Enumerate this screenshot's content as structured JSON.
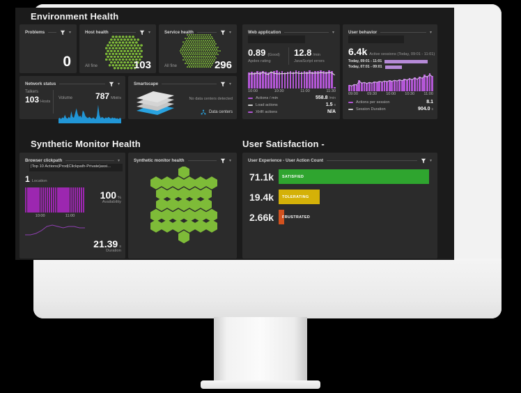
{
  "sections": {
    "environment_health": "Environment Health",
    "synthetic_monitor_health": "Synthetic Monitor Health",
    "user_satisfaction": "User Satisfaction -"
  },
  "tiles": {
    "problems": {
      "title": "Problems",
      "value": "0"
    },
    "host_health": {
      "title": "Host health",
      "status": "All fine",
      "value": "103"
    },
    "service_health": {
      "title": "Service health",
      "status": "All fine",
      "value": "296"
    },
    "network_status": {
      "title": "Network status",
      "talkers_label": "Talkers",
      "talkers_value": "103",
      "talkers_unit": "Hosts",
      "volume_label": "Volume",
      "volume_value": "787",
      "volume_unit": "Mbit/s"
    },
    "smartscape": {
      "title": "Smartscape",
      "empty_text": "No data centers detected",
      "link": "Data centers"
    },
    "web_application": {
      "title": "Web application",
      "apdex_value": "0.89",
      "apdex_qualifier": "(Good)",
      "apdex_label": "Apdex rating",
      "js_value": "12.8",
      "js_unit": "/min",
      "js_label": "JavaScript errors",
      "xticks": [
        "10:00",
        "10:30",
        "11:00",
        "11:30"
      ],
      "legend": [
        {
          "name": "Actions / min",
          "value": "558.8",
          "unit": "/min",
          "color": "#b357d6"
        },
        {
          "name": "Load actions",
          "value": "1.5",
          "unit": "s",
          "color": "#cfcfcf"
        },
        {
          "name": "XHR actions",
          "value": "N/A",
          "unit": "",
          "color": "#b357d6"
        }
      ]
    },
    "user_behavior": {
      "title": "User behavior",
      "sessions_value": "6.4k",
      "sessions_label": "Active sessions (Today, 09:01 - 11:01)",
      "compare": [
        {
          "label": "Today, 09:01 - 11:01",
          "pct": 100
        },
        {
          "label": "Today, 07:01 - 09:01",
          "pct": 40
        }
      ],
      "xticks": [
        "09:00",
        "09:30",
        "10:00",
        "10:30",
        "11:00"
      ],
      "legend": [
        {
          "name": "Actions per session",
          "value": "8.1",
          "unit": "",
          "color": "#b357d6"
        },
        {
          "name": "Session Duration",
          "value": "904.0",
          "unit": "s",
          "color": "#cfcfcf"
        }
      ]
    },
    "browser_clickpath": {
      "title": "Browser clickpath",
      "path": "|Top 10 Actions|Prod|Clickpath-Private|assi...",
      "location_value": "1",
      "location_label": "Location",
      "xticks": [
        "10:00",
        "11:00"
      ],
      "availability_value": "100",
      "availability_unit": "%",
      "availability_label": "Availability",
      "duration_value": "21.39",
      "duration_unit": "s",
      "duration_label": "Duration"
    },
    "synthetic_monitor_health": {
      "title": "Synthetic monitor health"
    },
    "user_experience": {
      "title": "User Experience - User Action Count"
    }
  },
  "chart_data": [
    {
      "id": "web_application_actions",
      "type": "bar",
      "title": "Web application — Actions / min",
      "xlabel": "",
      "ylabel": "Actions / min",
      "xticks": [
        "10:00",
        "10:30",
        "11:00",
        "11:30"
      ],
      "values": [
        72,
        74,
        70,
        76,
        73,
        78,
        75,
        70,
        74,
        77,
        79,
        73,
        76,
        72,
        75,
        78,
        74,
        80,
        76,
        73,
        77,
        75,
        79,
        74,
        78,
        76,
        80,
        77,
        75,
        79,
        76,
        6
      ],
      "color": "#b357d6",
      "overlay_line": [
        78,
        80,
        79,
        84,
        78,
        88,
        80,
        76,
        90,
        82,
        80,
        79,
        81,
        80,
        82,
        84,
        81,
        85,
        82,
        81,
        84,
        82,
        85,
        82,
        84,
        83,
        86,
        84,
        83,
        86,
        84,
        72
      ],
      "overlay_color": "#d7d7d7"
    },
    {
      "id": "user_behavior_actions",
      "type": "bar",
      "title": "User behavior — Actions per session",
      "xticks": [
        "09:00",
        "09:30",
        "10:00",
        "10:30",
        "11:00"
      ],
      "values": [
        30,
        26,
        34,
        30,
        52,
        40,
        44,
        38,
        44,
        40,
        46,
        42,
        48,
        44,
        50,
        46,
        52,
        48,
        54,
        50,
        56,
        52,
        58,
        54,
        62,
        56,
        66,
        58,
        70,
        64,
        78,
        72,
        86,
        74
      ],
      "color": "#b357d6",
      "overlay_line": [
        34,
        30,
        38,
        36,
        56,
        46,
        50,
        44,
        50,
        46,
        52,
        50,
        56,
        52,
        58,
        54,
        60,
        56,
        62,
        58,
        64,
        60,
        66,
        64,
        70,
        66,
        74,
        68,
        78,
        74,
        86,
        80,
        94,
        82
      ],
      "overlay_color": "#d0a8e6"
    },
    {
      "id": "network_volume",
      "type": "area",
      "title": "Network status — Volume",
      "color": "#2196d6",
      "values": [
        22,
        26,
        20,
        28,
        24,
        40,
        26,
        22,
        30,
        24,
        56,
        30,
        26,
        46,
        70,
        44,
        30,
        36,
        26,
        60,
        52,
        34,
        28,
        24,
        30,
        26,
        22,
        28,
        24,
        20,
        34,
        86,
        38,
        24,
        30,
        26,
        22,
        28,
        24,
        30,
        26,
        22,
        28,
        24,
        26,
        22,
        24,
        20,
        26,
        22
      ]
    },
    {
      "id": "clickpath_availability",
      "type": "bar",
      "title": "Browser clickpath — Availability",
      "xticks": [
        "10:00",
        "11:00"
      ],
      "values": [
        100,
        100,
        100,
        100,
        100,
        100,
        100,
        100,
        100,
        100,
        100,
        100,
        100,
        100,
        100,
        100,
        100,
        100,
        100,
        100,
        100,
        100,
        100,
        100,
        100,
        100,
        100,
        100
      ],
      "color": "#9c27b0"
    },
    {
      "id": "clickpath_duration",
      "type": "line",
      "title": "Browser clickpath — Duration",
      "color": "#8e3fb0",
      "values": [
        18,
        18,
        19,
        21,
        24,
        25,
        24,
        23,
        24,
        24,
        23,
        23
      ]
    },
    {
      "id": "user_experience_action_count",
      "type": "bar",
      "orientation": "horizontal",
      "title": "User Experience - User Action Count",
      "categories": [
        "SATISFIED",
        "TOLERATING",
        "FRUSTRATED"
      ],
      "value_labels": [
        "71.1k",
        "19.4k",
        "2.66k"
      ],
      "values": [
        71100,
        19400,
        2660
      ],
      "pct": [
        100,
        27.3,
        3.7
      ],
      "colors": [
        "#2fa52f",
        "#d4b108",
        "#d2511e"
      ]
    },
    {
      "id": "host_health_hexgrid",
      "type": "heatmap",
      "title": "Host health",
      "count": 103,
      "color": "#7ebb38"
    },
    {
      "id": "service_health_hexgrid",
      "type": "heatmap",
      "title": "Service health",
      "count": 296,
      "color": "#7ebb38"
    },
    {
      "id": "synthetic_monitor_hexgrid",
      "type": "heatmap",
      "title": "Synthetic monitor health",
      "rows": [
        1,
        6,
        5,
        5,
        6,
        6,
        1
      ],
      "color": "#7ebb38"
    }
  ]
}
